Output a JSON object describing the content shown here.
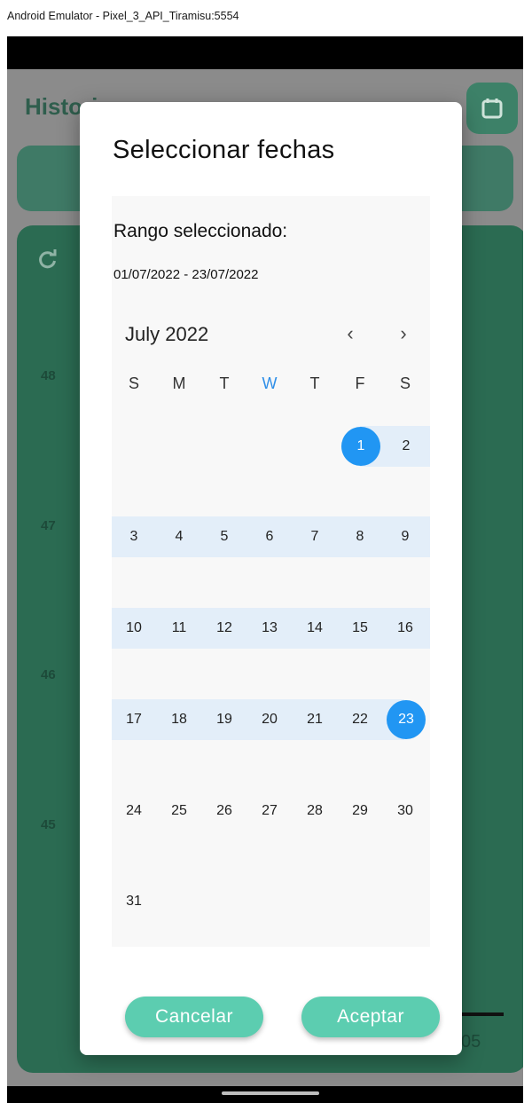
{
  "window": {
    "title": "Android Emulator - Pixel_3_API_Tiramisu:5554"
  },
  "background": {
    "title": "Histori",
    "y_labels": [
      "48",
      "47",
      "46",
      "45"
    ],
    "x_label_partial": "05",
    "accent_color": "#2b6b52"
  },
  "dialog": {
    "title": "Seleccionar fechas",
    "range_label": "Rango seleccionado:",
    "range_value": "01/07/2022 - 23/07/2022",
    "month_label": "July 2022",
    "prev_icon": "‹",
    "next_icon": "›",
    "weekdays": [
      "S",
      "M",
      "T",
      "W",
      "T",
      "F",
      "S"
    ],
    "today_weekday_index": 3,
    "days": [
      "1",
      "2",
      "3",
      "4",
      "5",
      "6",
      "7",
      "8",
      "9",
      "10",
      "11",
      "12",
      "13",
      "14",
      "15",
      "16",
      "17",
      "18",
      "19",
      "20",
      "21",
      "22",
      "23",
      "24",
      "25",
      "26",
      "27",
      "28",
      "29",
      "30",
      "31"
    ],
    "range_start": "1",
    "range_end": "23",
    "selected_color": "#2196f3",
    "range_band_color": "#e3eef9",
    "cancel_label": "Cancelar",
    "accept_label": "Aceptar",
    "button_color": "#5ccdb0"
  },
  "icons": {
    "calendar": "calendar-icon",
    "refresh": "refresh-icon",
    "prev": "chevron-left-icon",
    "next": "chevron-right-icon"
  }
}
